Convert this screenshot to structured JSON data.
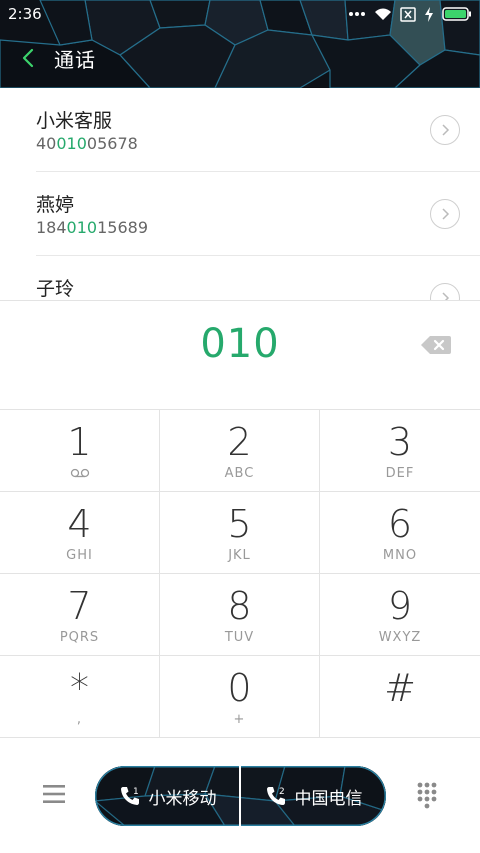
{
  "status_bar": {
    "time": "2:36",
    "icons": [
      "more-dots-icon",
      "wifi-icon",
      "no-sim-icon",
      "charging-icon",
      "battery-icon"
    ]
  },
  "header": {
    "title": "通话",
    "back_icon": "chevron-left-icon"
  },
  "results": [
    {
      "name": "小米客服",
      "number_pre": "40",
      "number_match": "010",
      "number_post": "05678"
    },
    {
      "name": "燕婷",
      "number_pre": "184",
      "number_match": "010",
      "number_post": "15689"
    },
    {
      "name": "子玲",
      "number_pre": "",
      "number_match": "",
      "number_post": ""
    }
  ],
  "dialer": {
    "input": "010"
  },
  "keypad": [
    {
      "digit": "1",
      "sub": ""
    },
    {
      "digit": "2",
      "sub": "ABC"
    },
    {
      "digit": "3",
      "sub": "DEF"
    },
    {
      "digit": "4",
      "sub": "GHI"
    },
    {
      "digit": "5",
      "sub": "JKL"
    },
    {
      "digit": "6",
      "sub": "MNO"
    },
    {
      "digit": "7",
      "sub": "PQRS"
    },
    {
      "digit": "8",
      "sub": "TUV"
    },
    {
      "digit": "9",
      "sub": "WXYZ"
    },
    {
      "digit": "*",
      "sub": ","
    },
    {
      "digit": "0",
      "sub": "+"
    },
    {
      "digit": "#",
      "sub": ""
    }
  ],
  "bottom": {
    "sim1_label": "小米移动",
    "sim2_label": "中国电信",
    "sim1_badge": "1",
    "sim2_badge": "2"
  },
  "colors": {
    "accent": "#26a96c",
    "header_bg": "#0d1117",
    "polygon_stroke": "#2a6f8a"
  }
}
